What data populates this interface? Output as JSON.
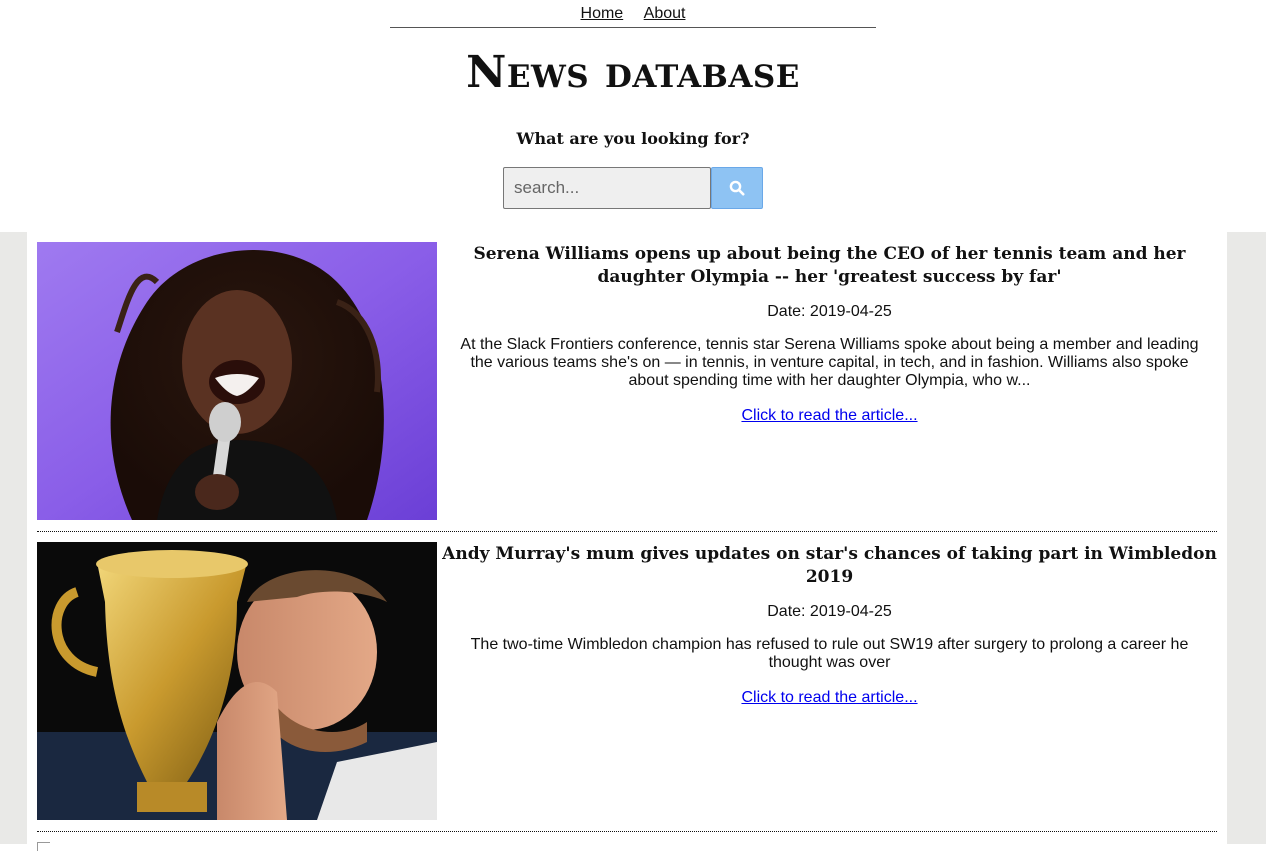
{
  "nav": {
    "home": "Home",
    "about": "About"
  },
  "site": {
    "title": "News database",
    "subtitle": "What are you looking for?"
  },
  "search": {
    "placeholder": "search...",
    "value": "",
    "button_icon": "search-icon",
    "button_color": "#8ec3f3"
  },
  "articles": [
    {
      "title": "Serena Williams opens up about being the CEO of her tennis team and her daughter Olympia -- her 'greatest success by far'",
      "date": "Date: 2019-04-25",
      "summary": "At the Slack Frontiers conference, tennis star Serena Williams spoke about being a member and leading the various teams she's on — in tennis, in venture capital, in tech, and in fashion. Williams also spoke about spending time with her daughter Olympia, who w...",
      "link": "Click to read the article...",
      "image": "photo-serena-williams-microphone"
    },
    {
      "title": "Andy Murray's mum gives updates on star's chances of taking part in Wimbledon 2019",
      "date": "Date: 2019-04-25",
      "summary": "The two-time Wimbledon champion has refused to rule out SW19 after surgery to prolong a career he thought was over",
      "link": "Click to read the article...",
      "image": "photo-andy-murray-trophy"
    }
  ],
  "colors": {
    "link": "#0000ee",
    "page_bg": "#e9e9e7",
    "panel_bg": "#ffffff"
  }
}
